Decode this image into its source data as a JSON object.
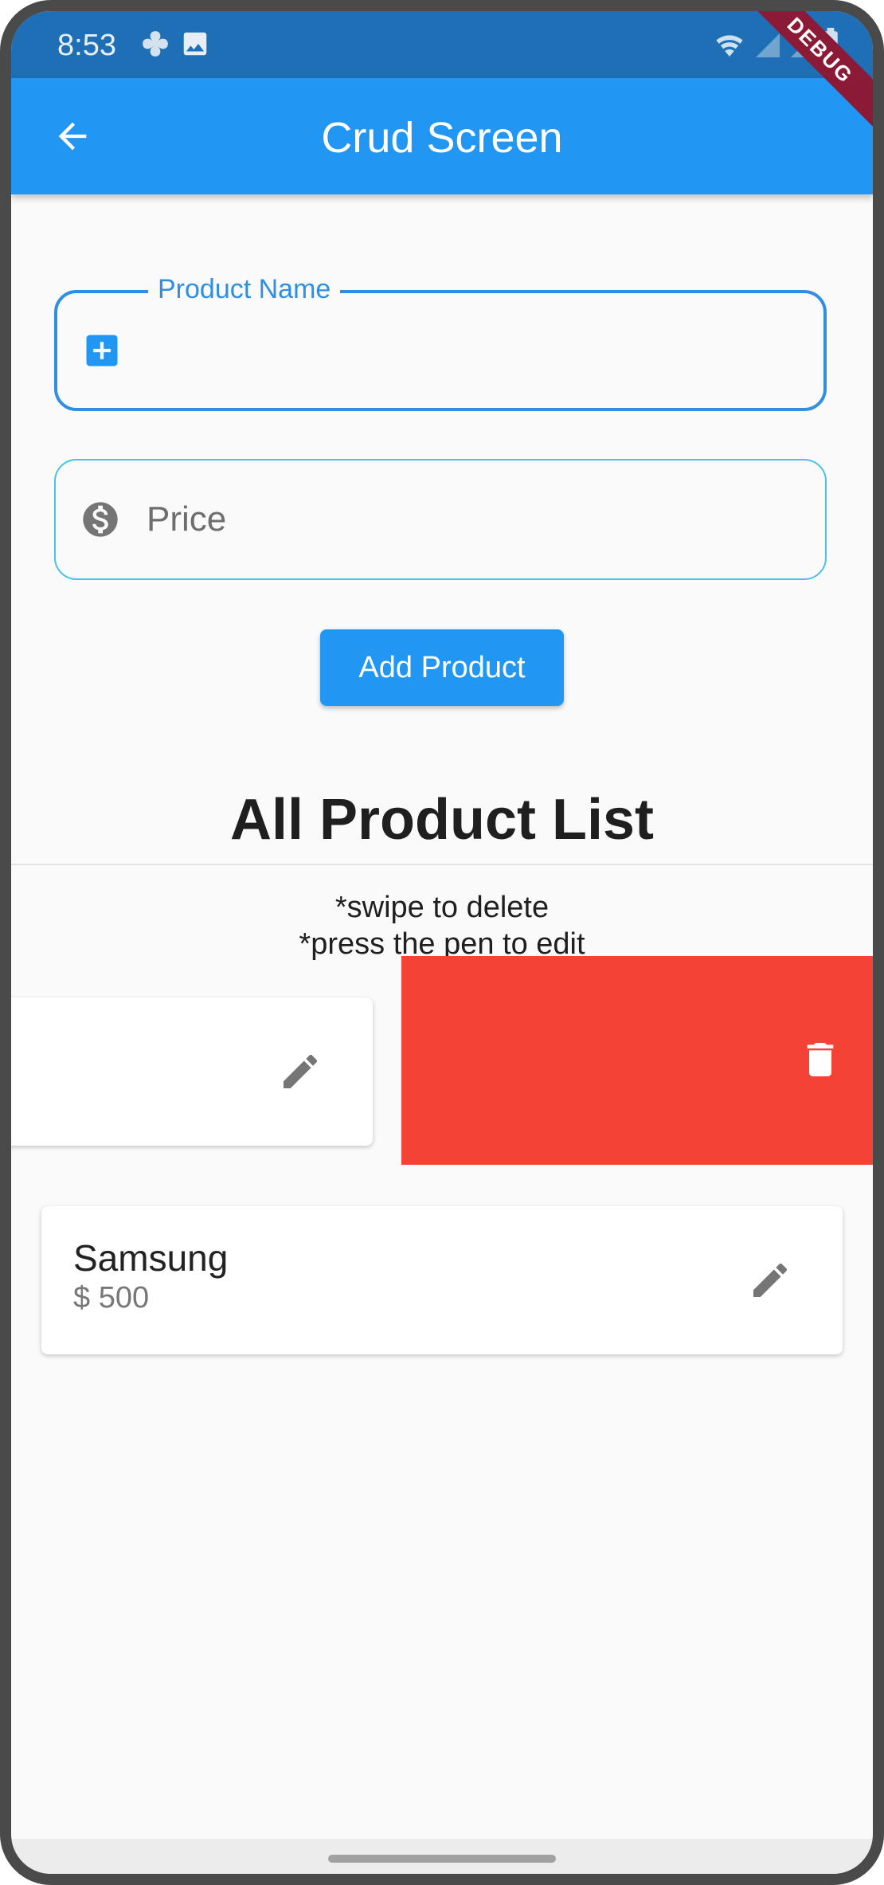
{
  "status_bar": {
    "time": "8:53",
    "icons": [
      "pinwheel-icon",
      "image-icon",
      "wifi-icon",
      "signal-icon",
      "signal-icon",
      "battery-icon"
    ]
  },
  "debug_banner": "DEBUG",
  "app_bar": {
    "title": "Crud Screen",
    "back_icon": "arrow-left-icon"
  },
  "form": {
    "product_name": {
      "label": "Product Name",
      "value": "",
      "icon": "add-box-icon"
    },
    "price": {
      "placeholder": "Price",
      "value": "",
      "icon": "dollar-circle-icon"
    },
    "submit_label": "Add Product"
  },
  "list": {
    "title": "All Product List",
    "hint_swipe": "*swipe to delete",
    "hint_edit": "*press the pen to edit",
    "items": [
      {
        "name": "",
        "price": "",
        "state": "swiping",
        "edit_icon": "pencil-icon",
        "delete_icon": "trash-icon"
      },
      {
        "name": "Samsung",
        "price": "$ 500",
        "state": "normal",
        "edit_icon": "pencil-icon"
      }
    ]
  },
  "colors": {
    "primary": "#2196f3",
    "status_bar": "#1e6fb6",
    "delete_bg": "#f44336",
    "background": "#fafafa"
  }
}
